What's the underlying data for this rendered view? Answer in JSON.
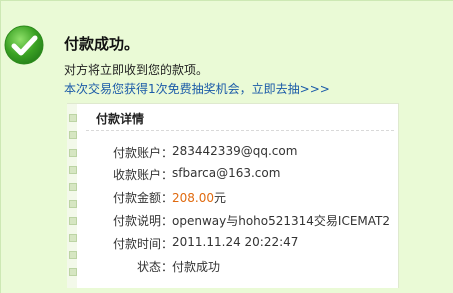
{
  "header": {
    "title": "付款成功。",
    "subtitle": "对方将立即收到您的款项。",
    "promo_link": "本次交易您获得1次免费抽奖机会，立即去抽>>>"
  },
  "details": {
    "heading": "付款详情",
    "rows": [
      {
        "label": "付款账户：",
        "value": "283442339@qq.com"
      },
      {
        "label": "收款账户：",
        "value": "sfbarca@163.com"
      },
      {
        "label": "付款金额：",
        "value": "208.00",
        "unit": "元"
      },
      {
        "label": "付款说明：",
        "value": "openway与hoho521314交易ICEMAT2"
      },
      {
        "label": "付款时间：",
        "value": "2011.11.24 20:22:47"
      },
      {
        "label": "状态：",
        "value": "付款成功"
      }
    ]
  },
  "colors": {
    "panel_bg": "#eafad6",
    "link": "#1a5aa8",
    "amount": "#e06a0f",
    "check": "#3aa123"
  },
  "icons": {
    "success": "check-circle-icon"
  }
}
